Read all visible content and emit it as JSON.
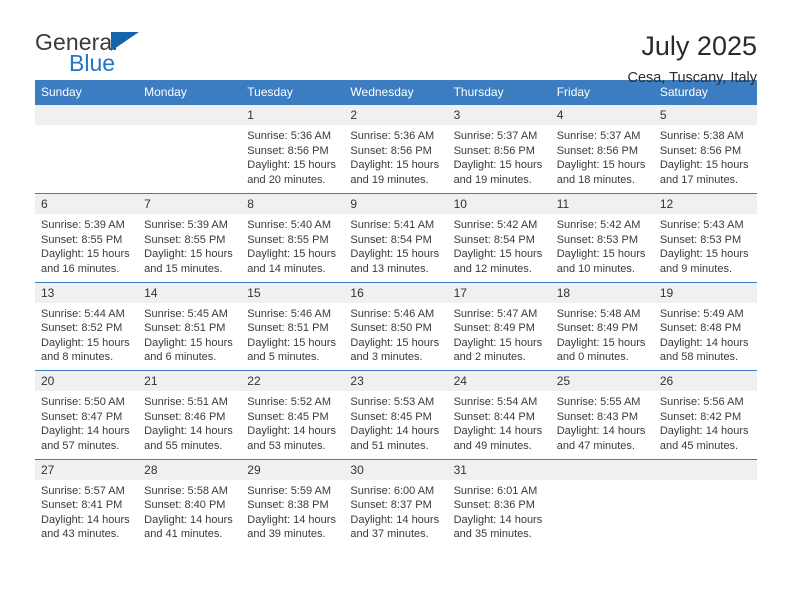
{
  "brand": {
    "name_part1": "General",
    "name_part2": "Blue",
    "triangle_icon": "triangle-logo-icon",
    "color_primary": "#1366ad",
    "color_text": "#3a3a3a"
  },
  "header": {
    "title": "July 2025",
    "location": "Cesa, Tuscany, Italy"
  },
  "theme": {
    "header_row_bg": "#3b7dc0",
    "header_row_text": "#ffffff",
    "daynum_bg": "#f0f0f0",
    "row_separator": "#3b7dc0",
    "body_text": "#3a3a3a"
  },
  "weekdays": [
    "Sunday",
    "Monday",
    "Tuesday",
    "Wednesday",
    "Thursday",
    "Friday",
    "Saturday"
  ],
  "labels": {
    "sunrise_prefix": "Sunrise:",
    "sunset_prefix": "Sunset:",
    "daylight_prefix": "Daylight:"
  },
  "weeks": [
    [
      {
        "day": "",
        "empty": true
      },
      {
        "day": "",
        "empty": true
      },
      {
        "day": "1",
        "sunrise": "Sunrise: 5:36 AM",
        "sunset": "Sunset: 8:56 PM",
        "daylight_l1": "Daylight: 15 hours",
        "daylight_l2": "and 20 minutes."
      },
      {
        "day": "2",
        "sunrise": "Sunrise: 5:36 AM",
        "sunset": "Sunset: 8:56 PM",
        "daylight_l1": "Daylight: 15 hours",
        "daylight_l2": "and 19 minutes."
      },
      {
        "day": "3",
        "sunrise": "Sunrise: 5:37 AM",
        "sunset": "Sunset: 8:56 PM",
        "daylight_l1": "Daylight: 15 hours",
        "daylight_l2": "and 19 minutes."
      },
      {
        "day": "4",
        "sunrise": "Sunrise: 5:37 AM",
        "sunset": "Sunset: 8:56 PM",
        "daylight_l1": "Daylight: 15 hours",
        "daylight_l2": "and 18 minutes."
      },
      {
        "day": "5",
        "sunrise": "Sunrise: 5:38 AM",
        "sunset": "Sunset: 8:56 PM",
        "daylight_l1": "Daylight: 15 hours",
        "daylight_l2": "and 17 minutes."
      }
    ],
    [
      {
        "day": "6",
        "sunrise": "Sunrise: 5:39 AM",
        "sunset": "Sunset: 8:55 PM",
        "daylight_l1": "Daylight: 15 hours",
        "daylight_l2": "and 16 minutes."
      },
      {
        "day": "7",
        "sunrise": "Sunrise: 5:39 AM",
        "sunset": "Sunset: 8:55 PM",
        "daylight_l1": "Daylight: 15 hours",
        "daylight_l2": "and 15 minutes."
      },
      {
        "day": "8",
        "sunrise": "Sunrise: 5:40 AM",
        "sunset": "Sunset: 8:55 PM",
        "daylight_l1": "Daylight: 15 hours",
        "daylight_l2": "and 14 minutes."
      },
      {
        "day": "9",
        "sunrise": "Sunrise: 5:41 AM",
        "sunset": "Sunset: 8:54 PM",
        "daylight_l1": "Daylight: 15 hours",
        "daylight_l2": "and 13 minutes."
      },
      {
        "day": "10",
        "sunrise": "Sunrise: 5:42 AM",
        "sunset": "Sunset: 8:54 PM",
        "daylight_l1": "Daylight: 15 hours",
        "daylight_l2": "and 12 minutes."
      },
      {
        "day": "11",
        "sunrise": "Sunrise: 5:42 AM",
        "sunset": "Sunset: 8:53 PM",
        "daylight_l1": "Daylight: 15 hours",
        "daylight_l2": "and 10 minutes."
      },
      {
        "day": "12",
        "sunrise": "Sunrise: 5:43 AM",
        "sunset": "Sunset: 8:53 PM",
        "daylight_l1": "Daylight: 15 hours",
        "daylight_l2": "and 9 minutes."
      }
    ],
    [
      {
        "day": "13",
        "sunrise": "Sunrise: 5:44 AM",
        "sunset": "Sunset: 8:52 PM",
        "daylight_l1": "Daylight: 15 hours",
        "daylight_l2": "and 8 minutes."
      },
      {
        "day": "14",
        "sunrise": "Sunrise: 5:45 AM",
        "sunset": "Sunset: 8:51 PM",
        "daylight_l1": "Daylight: 15 hours",
        "daylight_l2": "and 6 minutes."
      },
      {
        "day": "15",
        "sunrise": "Sunrise: 5:46 AM",
        "sunset": "Sunset: 8:51 PM",
        "daylight_l1": "Daylight: 15 hours",
        "daylight_l2": "and 5 minutes."
      },
      {
        "day": "16",
        "sunrise": "Sunrise: 5:46 AM",
        "sunset": "Sunset: 8:50 PM",
        "daylight_l1": "Daylight: 15 hours",
        "daylight_l2": "and 3 minutes."
      },
      {
        "day": "17",
        "sunrise": "Sunrise: 5:47 AM",
        "sunset": "Sunset: 8:49 PM",
        "daylight_l1": "Daylight: 15 hours",
        "daylight_l2": "and 2 minutes."
      },
      {
        "day": "18",
        "sunrise": "Sunrise: 5:48 AM",
        "sunset": "Sunset: 8:49 PM",
        "daylight_l1": "Daylight: 15 hours",
        "daylight_l2": "and 0 minutes."
      },
      {
        "day": "19",
        "sunrise": "Sunrise: 5:49 AM",
        "sunset": "Sunset: 8:48 PM",
        "daylight_l1": "Daylight: 14 hours",
        "daylight_l2": "and 58 minutes."
      }
    ],
    [
      {
        "day": "20",
        "sunrise": "Sunrise: 5:50 AM",
        "sunset": "Sunset: 8:47 PM",
        "daylight_l1": "Daylight: 14 hours",
        "daylight_l2": "and 57 minutes."
      },
      {
        "day": "21",
        "sunrise": "Sunrise: 5:51 AM",
        "sunset": "Sunset: 8:46 PM",
        "daylight_l1": "Daylight: 14 hours",
        "daylight_l2": "and 55 minutes."
      },
      {
        "day": "22",
        "sunrise": "Sunrise: 5:52 AM",
        "sunset": "Sunset: 8:45 PM",
        "daylight_l1": "Daylight: 14 hours",
        "daylight_l2": "and 53 minutes."
      },
      {
        "day": "23",
        "sunrise": "Sunrise: 5:53 AM",
        "sunset": "Sunset: 8:45 PM",
        "daylight_l1": "Daylight: 14 hours",
        "daylight_l2": "and 51 minutes."
      },
      {
        "day": "24",
        "sunrise": "Sunrise: 5:54 AM",
        "sunset": "Sunset: 8:44 PM",
        "daylight_l1": "Daylight: 14 hours",
        "daylight_l2": "and 49 minutes."
      },
      {
        "day": "25",
        "sunrise": "Sunrise: 5:55 AM",
        "sunset": "Sunset: 8:43 PM",
        "daylight_l1": "Daylight: 14 hours",
        "daylight_l2": "and 47 minutes."
      },
      {
        "day": "26",
        "sunrise": "Sunrise: 5:56 AM",
        "sunset": "Sunset: 8:42 PM",
        "daylight_l1": "Daylight: 14 hours",
        "daylight_l2": "and 45 minutes."
      }
    ],
    [
      {
        "day": "27",
        "sunrise": "Sunrise: 5:57 AM",
        "sunset": "Sunset: 8:41 PM",
        "daylight_l1": "Daylight: 14 hours",
        "daylight_l2": "and 43 minutes."
      },
      {
        "day": "28",
        "sunrise": "Sunrise: 5:58 AM",
        "sunset": "Sunset: 8:40 PM",
        "daylight_l1": "Daylight: 14 hours",
        "daylight_l2": "and 41 minutes."
      },
      {
        "day": "29",
        "sunrise": "Sunrise: 5:59 AM",
        "sunset": "Sunset: 8:38 PM",
        "daylight_l1": "Daylight: 14 hours",
        "daylight_l2": "and 39 minutes."
      },
      {
        "day": "30",
        "sunrise": "Sunrise: 6:00 AM",
        "sunset": "Sunset: 8:37 PM",
        "daylight_l1": "Daylight: 14 hours",
        "daylight_l2": "and 37 minutes."
      },
      {
        "day": "31",
        "sunrise": "Sunrise: 6:01 AM",
        "sunset": "Sunset: 8:36 PM",
        "daylight_l1": "Daylight: 14 hours",
        "daylight_l2": "and 35 minutes."
      },
      {
        "day": "",
        "empty": true
      },
      {
        "day": "",
        "empty": true
      }
    ]
  ]
}
